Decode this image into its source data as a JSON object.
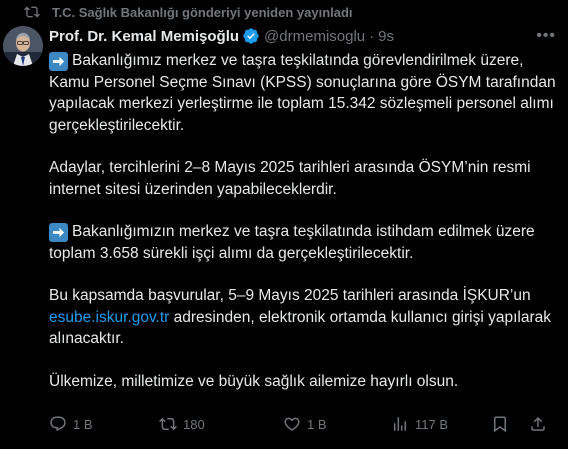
{
  "repost": {
    "text": "T.C. Sağlık Bakanlığı gönderiyi yeniden yayınladı",
    "icon": "repost-icon"
  },
  "author": {
    "name": "Prof. Dr. Kemal Memişoğlu",
    "handle": "@drmemisoglu",
    "separator": "·",
    "time": "9s",
    "verified_color": "#1d9bf0"
  },
  "tweet": {
    "p1_rest": "Bakanlığımız merkez ve taşra teşkilatında görevlendirilmek üzere, Kamu Personel Seçme Sınavı (KPSS) sonuçlarına göre ÖSYM tarafından yapılacak merkezi yerleştirme ile toplam 15.342 sözleşmeli personel alımı gerçekleştirilecektir.",
    "p2": "Adaylar, tercihlerini 2–8 Mayıs 2025 tarihleri arasında ÖSYM’nin resmi internet sitesi üzerinden yapabileceklerdir.",
    "p3_rest": "Bakanlığımızın merkez ve taşra teşkilatında istihdam edilmek üzere toplam 3.658 sürekli işçi alımı da gerçekleştirilecektir.",
    "p4_before": "Bu kapsamda başvurular, 5–9 Mayıs 2025 tarihleri arasında İŞKUR’un ",
    "p4_link": "esube.iskur.gov.tr",
    "p4_after": " adresinden, elektronik ortamda kullanıcı girişi yapılarak alınacaktır.",
    "p5": "Ülkemize, milletimize ve büyük sağlık ailemize hayırlı olsun."
  },
  "actions": {
    "reply_count": "1 B",
    "repost_count": "180",
    "like_count": "1 B",
    "view_count": "117 B"
  },
  "colors": {
    "background": "#000000",
    "text": "#e7e9ea",
    "muted": "#71767b",
    "link": "#1d9bf0",
    "arrow_emoji_bg": "#3b88c3"
  }
}
